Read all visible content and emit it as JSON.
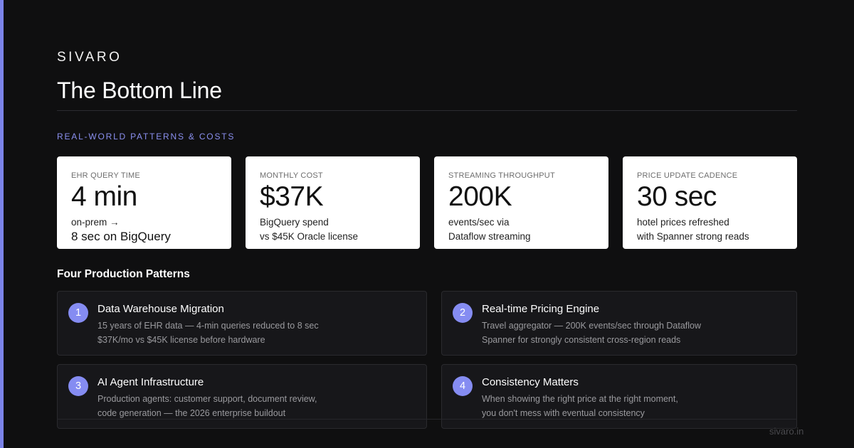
{
  "brand": "SIVARO",
  "title": "The Bottom Line",
  "section_label": "REAL-WORLD PATTERNS & COSTS",
  "colors": {
    "accent": "#7b83e8",
    "badge": "#858cf2",
    "section_label": "#8b90f0",
    "background": "#0f0f10"
  },
  "stats": [
    {
      "label": "EHR QUERY TIME",
      "value": "4 min",
      "sub1": "on-prem →",
      "sub2": "8 sec on BigQuery"
    },
    {
      "label": "MONTHLY COST",
      "value": "$37K",
      "sub1": "BigQuery spend",
      "sub2": "vs $45K Oracle license"
    },
    {
      "label": "STREAMING THROUGHPUT",
      "value": "200K",
      "sub1": "events/sec via",
      "sub2": "Dataflow streaming"
    },
    {
      "label": "PRICE UPDATE CADENCE",
      "value": "30 sec",
      "sub1": "hotel prices refreshed",
      "sub2": "with Spanner strong reads"
    }
  ],
  "patterns_heading": "Four Production Patterns",
  "patterns": [
    {
      "num": "1",
      "title": "Data Warehouse Migration",
      "line1": "15 years of EHR data — 4-min queries reduced to 8 sec",
      "line2": "$37K/mo vs $45K license before hardware"
    },
    {
      "num": "2",
      "title": "Real-time Pricing Engine",
      "line1": "Travel aggregator — 200K events/sec through Dataflow",
      "line2": "Spanner for strongly consistent cross-region reads"
    },
    {
      "num": "3",
      "title": "AI Agent Infrastructure",
      "line1": "Production agents: customer support, document review,",
      "line2": "code generation — the 2026 enterprise buildout"
    },
    {
      "num": "4",
      "title": "Consistency Matters",
      "line1": "When showing the right price at the right moment,",
      "line2": "you don't mess with eventual consistency"
    }
  ],
  "footer_url": "sivaro.in"
}
